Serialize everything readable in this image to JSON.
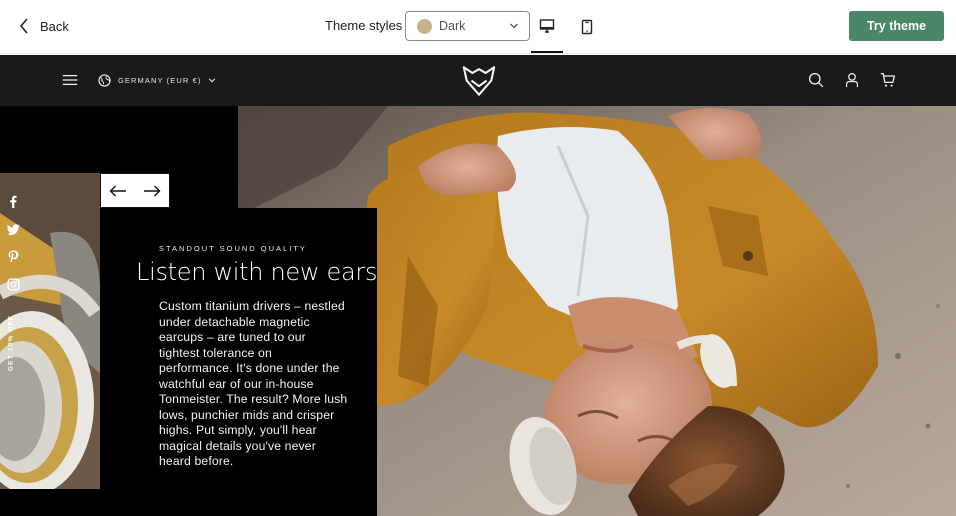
{
  "topbar": {
    "back_label": "Back",
    "theme_styles_label": "Theme styles",
    "theme_select": {
      "value": "Dark",
      "swatch_color": "#c9b48a"
    },
    "devices": [
      "desktop-icon",
      "mobile-icon"
    ],
    "active_device": "desktop",
    "try_button_label": "Try theme",
    "try_button_color": "#4a8668"
  },
  "store_header": {
    "locale_label": "GERMANY (EUR €)",
    "background_color": "#1a1a1a",
    "icons": [
      "menu-icon",
      "globe-icon",
      "fox-logo",
      "search-icon",
      "account-icon",
      "cart-icon"
    ]
  },
  "hero": {
    "eyebrow": "STANDOUT SOUND QUALITY",
    "headline": "Listen with new ears",
    "body": "Custom titanium drivers – nestled under detachable magnetic earcups – are tuned to our tightest tolerance on performance. It's done under the watchful ear of our in-house Tonmeister. The result? More lush lows, punchier mids and crisper highs. Put simply, you'll hear magical details you've never heard before.",
    "slide_nav": [
      "previous-arrow-icon",
      "next-arrow-icon"
    ],
    "social_icons": [
      "facebook-icon",
      "twitter-icon",
      "pinterest-icon",
      "instagram-icon"
    ],
    "discount_tab_label": "GET 10% OFF"
  }
}
